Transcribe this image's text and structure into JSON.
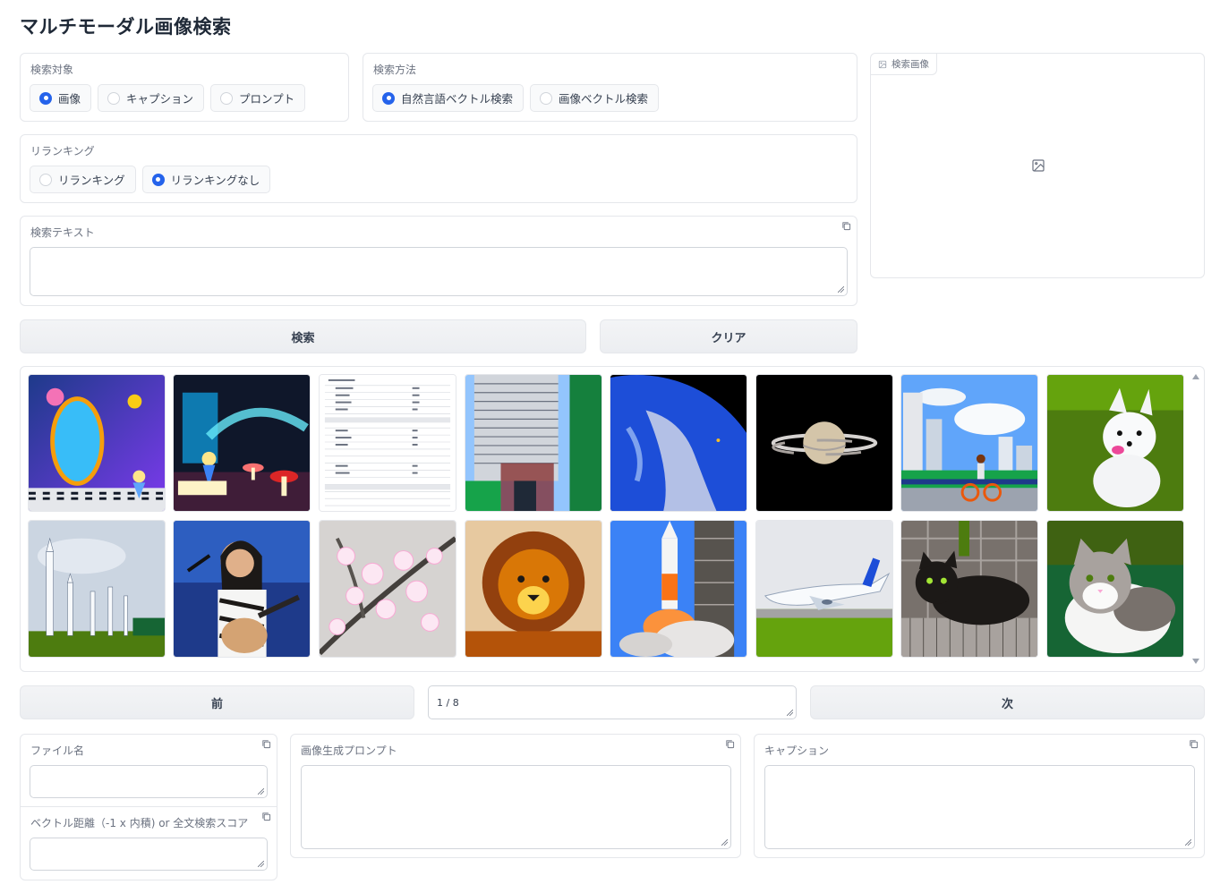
{
  "app": {
    "title": "マルチモーダル画像検索"
  },
  "search_target": {
    "label": "検索対象",
    "options": [
      "画像",
      "キャプション",
      "プロンプト"
    ],
    "selected": "画像"
  },
  "search_method": {
    "label": "検索方法",
    "options": [
      "自然言語ベクトル検索",
      "画像ベクトル検索"
    ],
    "selected": "自然言語ベクトル検索"
  },
  "reranking": {
    "label": "リランキング",
    "options": [
      "リランキング",
      "リランキングなし"
    ],
    "selected": "リランキングなし"
  },
  "search_text": {
    "label": "検索テキスト",
    "value": ""
  },
  "search_image": {
    "label": "検索画像"
  },
  "buttons": {
    "search": "検索",
    "clear": "クリア",
    "prev": "前",
    "next": "次"
  },
  "pager": {
    "value": "1 / 8"
  },
  "gallery": {
    "items": [
      "alice-mirror",
      "alice-book",
      "document-table",
      "apartment-building",
      "earth-from-space",
      "saturn",
      "city-cyclist",
      "white-puppy",
      "rocket-garden",
      "singer-guitar",
      "cherry-blossoms",
      "lion",
      "rocket-launch",
      "airbus-a380",
      "black-cat",
      "tabby-cat"
    ]
  },
  "details": {
    "file_name": {
      "label": "ファイル名",
      "value": ""
    },
    "vector_distance": {
      "label": "ベクトル距離（-1 x 内積) or 全文検索スコア",
      "value": ""
    },
    "generation_prompt": {
      "label": "画像生成プロンプト",
      "value": ""
    },
    "caption": {
      "label": "キャプション",
      "value": ""
    }
  },
  "colors": {
    "accent": "#2563eb",
    "border": "#e5e7eb",
    "button_bg": "#f3f4f6"
  }
}
